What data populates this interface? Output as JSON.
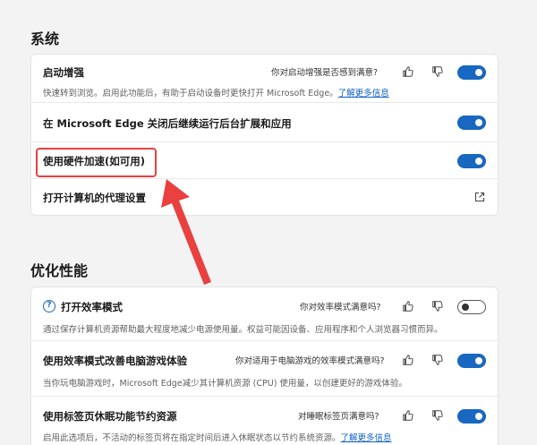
{
  "system": {
    "title": "系统",
    "startup_boost": {
      "title": "启动增强",
      "feedback_question": "你对启动增强是否感到满意?",
      "description": "快速转到浏览。启用此功能后，有助于启动设备时更快打开 Microsoft Edge。",
      "learn_more": "了解更多信息",
      "enabled": true
    },
    "background_apps": {
      "title": "在 Microsoft Edge 关闭后继续运行后台扩展和应用",
      "enabled": true
    },
    "hardware_accel": {
      "title": "使用硬件加速(如可用)",
      "enabled": true
    },
    "proxy": {
      "title": "打开计算机的代理设置"
    }
  },
  "performance": {
    "title": "优化性能",
    "efficiency_mode": {
      "title": "打开效率模式",
      "feedback_question": "你对效率模式满意吗?",
      "description": "通过保存计算机资源帮助最大程度地减少电源使用量。权益可能因设备、应用程序和个人浏览器习惯而异。",
      "enabled": false
    },
    "gaming": {
      "title": "使用效率模式改善电脑游戏体验",
      "feedback_question": "你对适用于电脑游戏的效率模式满意吗?",
      "description": "当你玩电脑游戏时，Microsoft Edge减少其计算机资源 (CPU) 使用量，以创建更好的游戏体验。",
      "enabled": true
    },
    "sleeping_tabs": {
      "title": "使用标签页休眠功能节约资源",
      "feedback_question": "对睡眠标签页满意吗?",
      "description": "启用此选项后，不活动的标签页将在指定时间后进入休眠状态以节约系统资源。",
      "learn_more": "了解更多信息",
      "enabled": true
    }
  },
  "colors": {
    "accent": "#1867c0",
    "annotation": "#e8413f"
  }
}
